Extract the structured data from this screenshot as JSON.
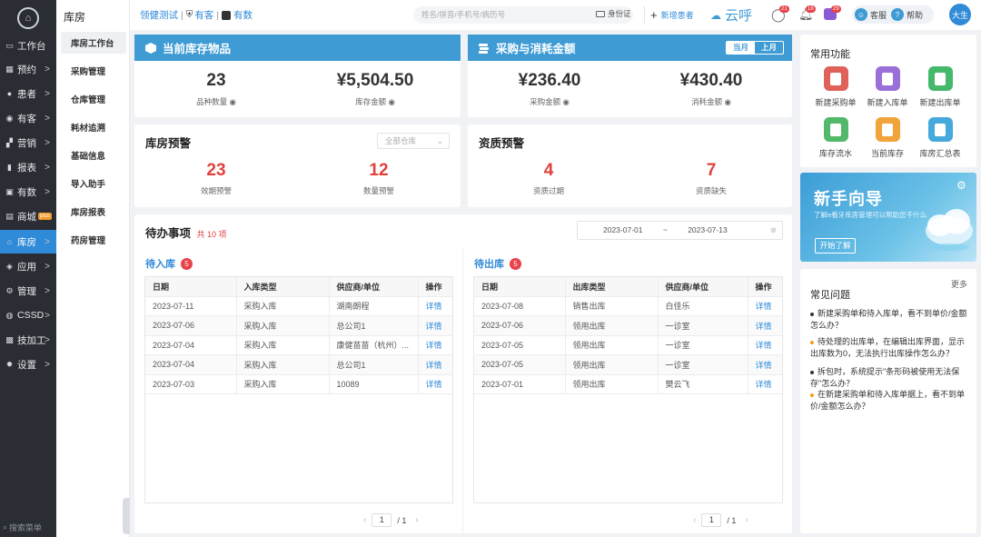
{
  "sidebar": {
    "items": [
      {
        "label": "工作台",
        "icon": "monitor-icon",
        "chev": ""
      },
      {
        "label": "预约",
        "icon": "calendar-icon",
        "chev": ">"
      },
      {
        "label": "患者",
        "icon": "user-icon",
        "chev": ">"
      },
      {
        "label": "有客",
        "icon": "eye-icon",
        "chev": ">"
      },
      {
        "label": "营销",
        "icon": "grid-icon",
        "chev": ">"
      },
      {
        "label": "报表",
        "icon": "bar-chart-icon",
        "chev": ">"
      },
      {
        "label": "有数",
        "icon": "chart-box-icon",
        "chev": ">"
      },
      {
        "label": "商城",
        "icon": "shop-icon",
        "chev": "",
        "badge": "plus"
      },
      {
        "label": "库房",
        "icon": "warehouse-icon",
        "chev": ">"
      },
      {
        "label": "应用",
        "icon": "apps-icon",
        "chev": ">"
      },
      {
        "label": "管理",
        "icon": "gear-icon",
        "chev": ">"
      },
      {
        "label": "CSSD",
        "icon": "sterilize-icon",
        "chev": ">"
      },
      {
        "label": "技加工",
        "icon": "tool-icon",
        "chev": ">"
      },
      {
        "label": "设置",
        "icon": "settings-icon",
        "chev": ">"
      }
    ],
    "search_label": "搜索菜单"
  },
  "subnav": {
    "title": "库房",
    "items": [
      "库房工作台",
      "采购管理",
      "仓库管理",
      "耗材追溯",
      "基础信息",
      "导入助手",
      "库房报表",
      "药房管理"
    ]
  },
  "topbar": {
    "org": "领健测试",
    "link1": "有客",
    "link2": "有数",
    "search_placeholder": "姓名/拼音/手机号/病历号",
    "idcard": "身份证",
    "new_patient": "新增患者",
    "cloud": "云呼",
    "badge1": "21",
    "badge2": "18",
    "badge3": "29",
    "service": "客服",
    "help": "帮助",
    "avatar": "大生"
  },
  "inventory": {
    "title": "当前库存物品",
    "count": "23",
    "count_label": "品种数量",
    "amount": "¥5,504.50",
    "amount_label": "库存金额"
  },
  "purchase": {
    "title": "采购与消耗金额",
    "tab_current": "当月",
    "tab_last": "上月",
    "purchase_amount": "¥236.40",
    "purchase_label": "采购金额",
    "consume_amount": "¥430.40",
    "consume_label": "消耗金额"
  },
  "warehouse_alert": {
    "title": "库房预警",
    "select": "全部仓库",
    "expiry": "23",
    "expiry_label": "效期预警",
    "quantity": "12",
    "quantity_label": "数量预警"
  },
  "qualification_alert": {
    "title": "资质预警",
    "expired": "4",
    "expired_label": "资质过期",
    "missing": "7",
    "missing_label": "资质缺失"
  },
  "todo": {
    "title": "待办事项",
    "total": "共 10 项",
    "date_from": "2023-07-01",
    "date_sep": "~",
    "date_to": "2023-07-13",
    "inbound": {
      "title": "待入库",
      "count": "5",
      "headers": [
        "日期",
        "入库类型",
        "供应商/单位",
        "操作"
      ],
      "rows": [
        [
          "2023-07-11",
          "采购入库",
          "湖南朗程",
          "详情"
        ],
        [
          "2023-07-06",
          "采购入库",
          "总公司1",
          "详情"
        ],
        [
          "2023-07-04",
          "采购入库",
          "康健苗苗（杭州）...",
          "详情"
        ],
        [
          "2023-07-04",
          "采购入库",
          "总公司1",
          "详情"
        ],
        [
          "2023-07-03",
          "采购入库",
          "10089",
          "详情"
        ]
      ],
      "page": "1",
      "pages": "/ 1"
    },
    "outbound": {
      "title": "待出库",
      "count": "5",
      "headers": [
        "日期",
        "出库类型",
        "供应商/单位",
        "操作"
      ],
      "rows": [
        [
          "2023-07-08",
          "销售出库",
          "白佳乐",
          "详情"
        ],
        [
          "2023-07-06",
          "领用出库",
          "一诊室",
          "详情"
        ],
        [
          "2023-07-05",
          "领用出库",
          "一诊室",
          "详情"
        ],
        [
          "2023-07-05",
          "领用出库",
          "一诊室",
          "详情"
        ],
        [
          "2023-07-01",
          "领用出库",
          "樊云飞",
          "详情"
        ]
      ],
      "page": "1",
      "pages": "/ 1"
    }
  },
  "functions": {
    "title": "常用功能",
    "items": [
      {
        "label": "新建采购单",
        "color": "#e0605a"
      },
      {
        "label": "新建入库单",
        "color": "#9b6fd8"
      },
      {
        "label": "新建出库单",
        "color": "#45b86b"
      },
      {
        "label": "库存流水",
        "color": "#53b96a"
      },
      {
        "label": "当前库存",
        "color": "#f0a43a"
      },
      {
        "label": "库房汇总表",
        "color": "#45a9dc"
      }
    ]
  },
  "guide": {
    "title": "新手向导",
    "subtitle": "了解e看牙库房管理可以帮助您干什么",
    "button": "开始了解"
  },
  "faq": {
    "title": "常见问题",
    "more": "更多",
    "items": [
      "新建采购单和待入库单，看不到单价/金额怎么办？",
      "待处理的出库单，在编辑出库界面，显示出库数为0，无法执行出库操作怎么办？",
      "拆包时，系统提示\"条形码被使用无法保存\"怎么办？",
      "在新建采购单和待入库单据上，看不到单价/金额怎么办？"
    ]
  }
}
